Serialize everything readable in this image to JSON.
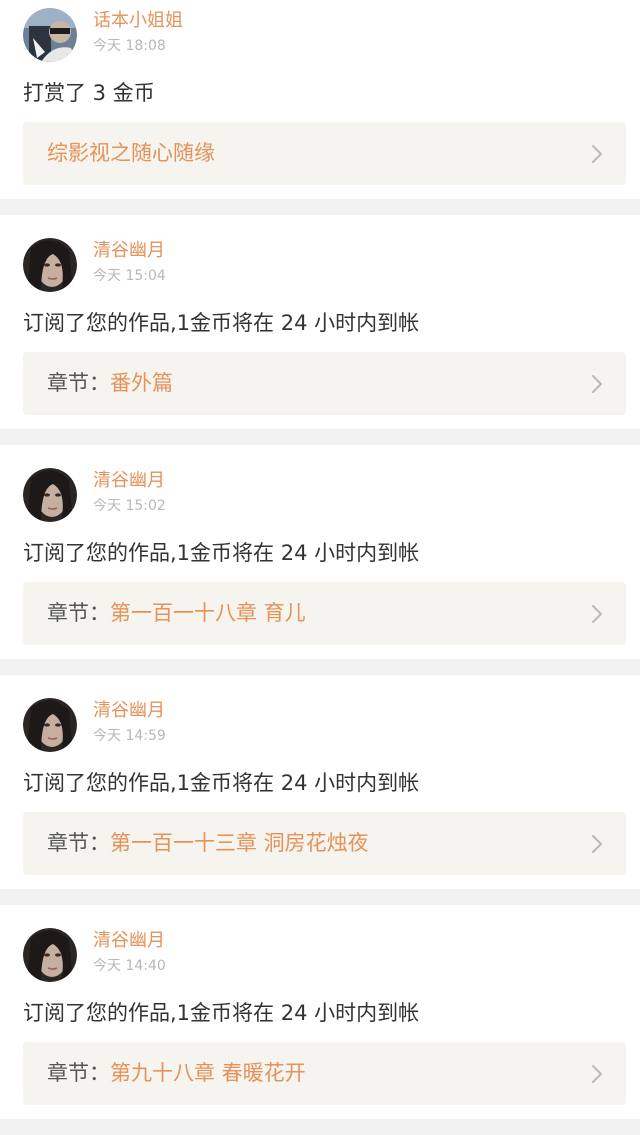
{
  "colors": {
    "accent": "#e6925a",
    "page_background": "#f2f2f2",
    "link_bar_background": "#f5f4ee",
    "time_text": "#b8b8b8"
  },
  "notifications": [
    {
      "avatar": "user-avatar-1",
      "username": "话本小姐姐",
      "time": "今天 18:08",
      "message": "打赏了 3 金币",
      "link_prefix": "",
      "link_title": "综影视之随心随缘",
      "link_icon": "chevron-right-icon"
    },
    {
      "avatar": "user-avatar-2",
      "username": "清谷幽月",
      "time": "今天 15:04",
      "message": "订阅了您的作品,1金币将在 24 小时内到帐",
      "link_prefix": "章节：",
      "link_title": "番外篇",
      "link_icon": "chevron-right-icon"
    },
    {
      "avatar": "user-avatar-2",
      "username": "清谷幽月",
      "time": "今天 15:02",
      "message": "订阅了您的作品,1金币将在 24 小时内到帐",
      "link_prefix": "章节：",
      "link_title": "第一百一十八章 育儿",
      "link_icon": "chevron-right-icon"
    },
    {
      "avatar": "user-avatar-2",
      "username": "清谷幽月",
      "time": "今天 14:59",
      "message": "订阅了您的作品,1金币将在 24 小时内到帐",
      "link_prefix": "章节：",
      "link_title": "第一百一十三章 洞房花烛夜",
      "link_icon": "chevron-right-icon"
    },
    {
      "avatar": "user-avatar-2",
      "username": "清谷幽月",
      "time": "今天 14:40",
      "message": "订阅了您的作品,1金币将在 24 小时内到帐",
      "link_prefix": "章节：",
      "link_title": "第九十八章 春暖花开",
      "link_icon": "chevron-right-icon"
    }
  ]
}
